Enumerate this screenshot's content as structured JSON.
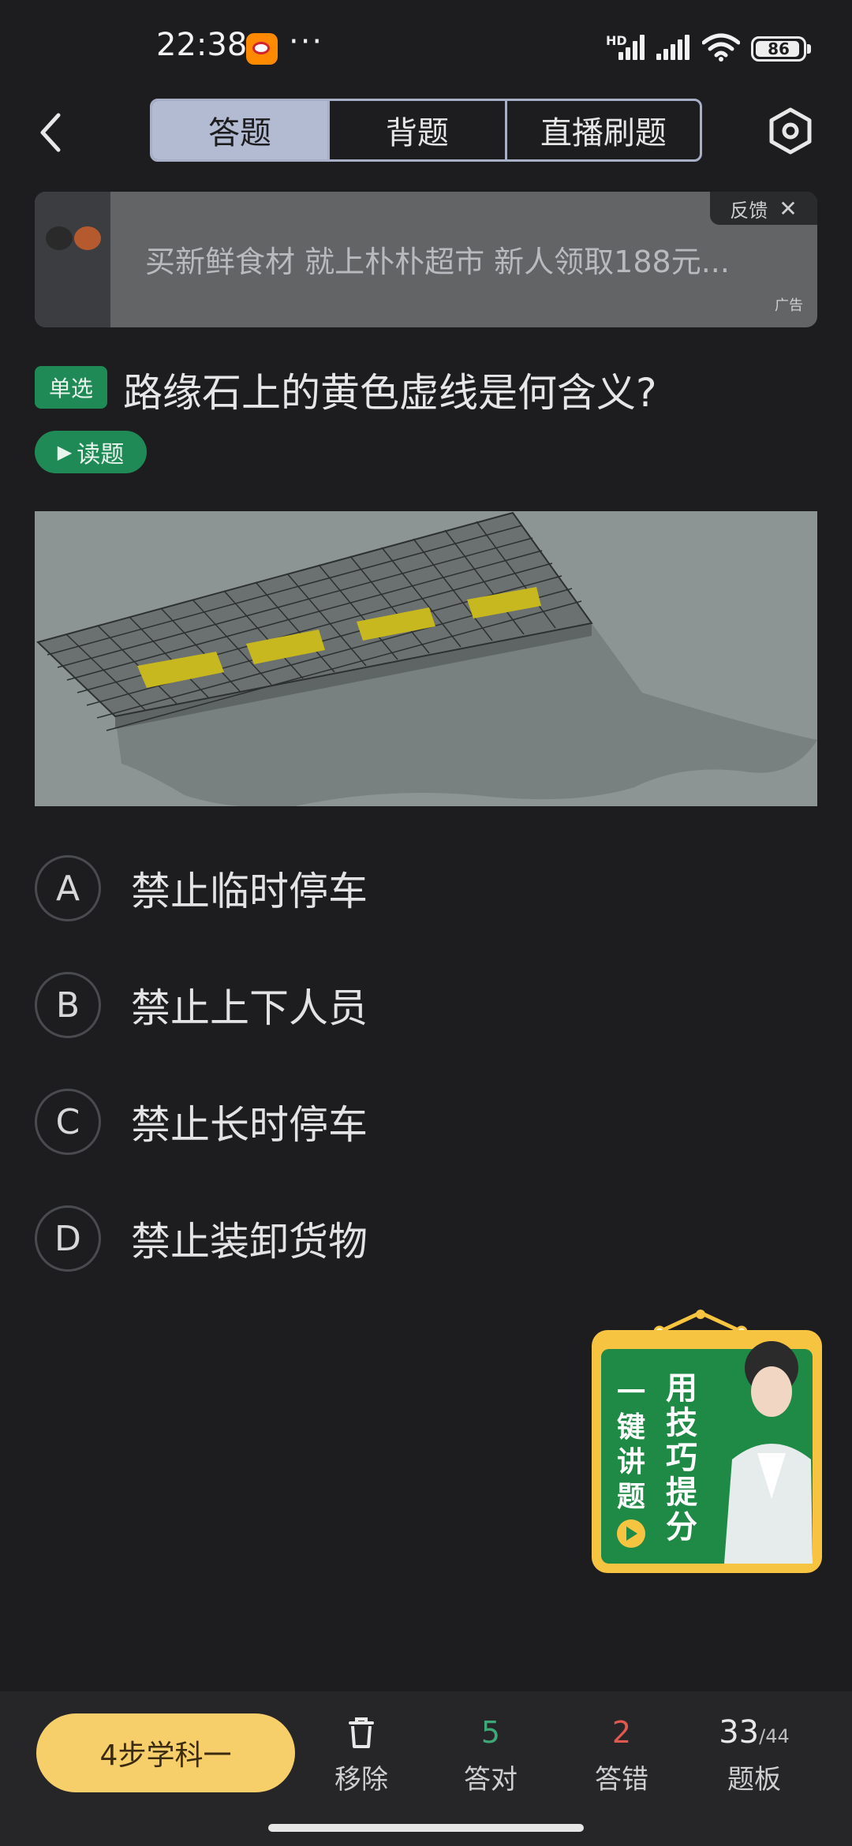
{
  "status_bar": {
    "time": "22:38",
    "dots": "···",
    "hd": "HD",
    "battery": "86"
  },
  "header": {
    "tabs": [
      {
        "label": "答题",
        "active": true
      },
      {
        "label": "背题",
        "active": false
      },
      {
        "label": "直播刷题",
        "active": false
      }
    ],
    "back_icon": "chevron-left-icon",
    "settings_icon": "hexagon-settings-icon"
  },
  "ad": {
    "text": "买新鲜食材 就上朴朴超市 新人领取188元...",
    "feedback_label": "反馈",
    "tag": "广告"
  },
  "question": {
    "type_badge": "单选",
    "text": "路缘石上的黄色虚线是何含义?",
    "read_button": "读题"
  },
  "options": [
    {
      "letter": "A",
      "text": "禁止临时停车"
    },
    {
      "letter": "B",
      "text": "禁止上下人员"
    },
    {
      "letter": "C",
      "text": "禁止长时停车"
    },
    {
      "letter": "D",
      "text": "禁止装卸货物"
    }
  ],
  "promo": {
    "line1": "用技巧提分",
    "line2": "一键讲题"
  },
  "bottom_bar": {
    "cta": "4步学科一",
    "remove_label": "移除",
    "correct_count": "5",
    "correct_label": "答对",
    "wrong_count": "2",
    "wrong_label": "答错",
    "progress_current": "33",
    "progress_total": "/44",
    "board_label": "题板"
  },
  "colors": {
    "background": "#1d1d1f",
    "accent_green": "#1f8a55",
    "cta_yellow": "#f6cf6b",
    "correct": "#3fa878",
    "wrong": "#e0584f"
  }
}
